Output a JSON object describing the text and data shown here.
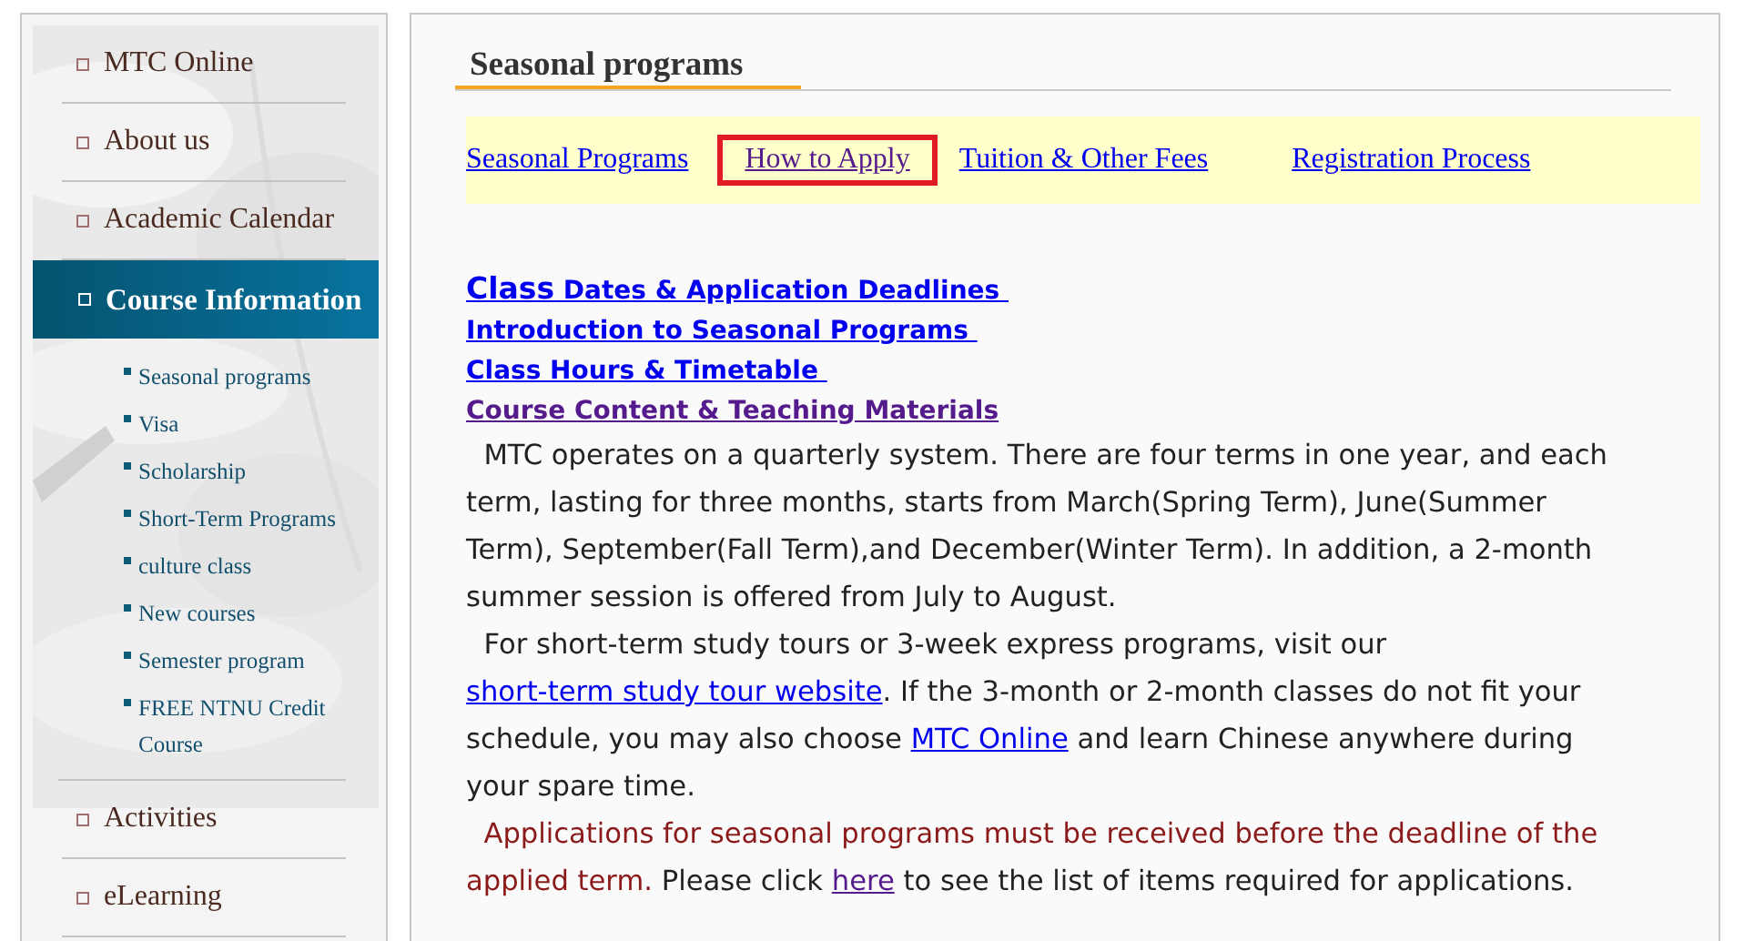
{
  "sidebar": {
    "items": [
      {
        "label": "MTC Online",
        "selected": false
      },
      {
        "label": "About us",
        "selected": false
      },
      {
        "label": "Academic Calendar",
        "selected": false
      },
      {
        "label": "Course Information",
        "selected": true,
        "children": [
          {
            "label": "Seasonal programs"
          },
          {
            "label": "Visa"
          },
          {
            "label": "Scholarship"
          },
          {
            "label": "Short-Term Programs"
          },
          {
            "label": "culture class"
          },
          {
            "label": "New courses"
          },
          {
            "label": "Semester program"
          },
          {
            "label": "FREE NTNU Credit Course"
          }
        ]
      },
      {
        "label": "Activities",
        "selected": false
      },
      {
        "label": "eLearning",
        "selected": false
      }
    ]
  },
  "main": {
    "title": "Seasonal programs",
    "tabs": [
      {
        "label": "Seasonal Programs",
        "selected": false,
        "visited": false
      },
      {
        "label": "How to Apply",
        "selected": true,
        "visited": true
      },
      {
        "label": "Tuition & Other Fees",
        "selected": false,
        "visited": false
      },
      {
        "label": "Registration Process",
        "selected": false,
        "visited": false
      }
    ],
    "section_links": [
      {
        "lead": "Class",
        "label": " Dates & Application Deadlines ",
        "visited": false
      },
      {
        "label": "Introduction to Seasonal Programs ",
        "visited": false
      },
      {
        "label": "Class Hours & Timetable ",
        "visited": false
      },
      {
        "label": "Course Content & Teaching Materials",
        "visited": true
      }
    ],
    "paragraphs": [
      [
        {
          "kind": "text",
          "text": "  MTC operates on a quarterly system. There are four terms in one year, and each term, lasting for three months, starts from March(Spring Term), June(Summer Term), September(Fall Term),and December(Winter Term). In addition, a 2-month summer session is offered from July to August."
        }
      ],
      [
        {
          "kind": "text",
          "text": "  For short-term study tours or 3-week express programs, visit our "
        },
        {
          "kind": "link",
          "text": "short-term study tour website",
          "visited": false
        },
        {
          "kind": "text",
          "text": ". If the 3-month or 2-month classes do not fit your schedule, you may also choose "
        },
        {
          "kind": "link",
          "text": "MTC Online",
          "visited": false
        },
        {
          "kind": "text",
          "text": " and learn Chinese anywhere during your spare time."
        }
      ],
      [
        {
          "kind": "note",
          "text": "  Applications for seasonal programs must be received before the deadline of the applied term."
        },
        {
          "kind": "text",
          "text": " Please click "
        },
        {
          "kind": "link",
          "text": "here",
          "visited": true
        },
        {
          "kind": "text",
          "text": " to see the list of items required for applications."
        }
      ]
    ]
  }
}
